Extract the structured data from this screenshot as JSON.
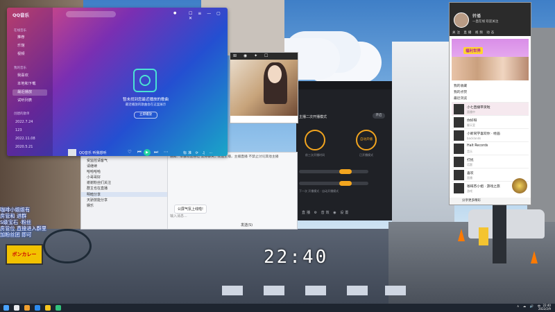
{
  "desktop": {
    "clock": "22:40",
    "danmaku": [
      "咖啡小姐姐有",
      "房管和 进群",
      "S级宝石 ·粉丝",
      "房管位 直接进入群里",
      "加粉丝团 即可"
    ],
    "shop_sign": "ボンカレー"
  },
  "qq_music": {
    "app_name": "QQ音乐",
    "sections": [
      "在线音乐",
      "我的音乐",
      "创建的歌单"
    ],
    "nav_items": [
      "推荐",
      "乐馆",
      "视频",
      "我喜欢",
      "本地和下载",
      "最近播放",
      "试听列表"
    ],
    "playlists": [
      "2022.7.24",
      "123",
      "2022.11.08",
      "2020.5.21"
    ],
    "empty_title": "暂未找到您最近播放的歌曲",
    "empty_subtitle": "最近播放的歌曲会在这里展示",
    "empty_button": "立即播放",
    "now_playing": "QQ音乐 听我想听",
    "window_controls": "☐ ≡ — ▢ ✕",
    "player_tools": "标准 ⟳ ♫ ⋯"
  },
  "chat_window": {
    "system_message": "通知：本群欢迎各位 友好聊天，欢迎主播，主播直播 不禁止讨论其他主播",
    "conversations": [
      "受监控请客气",
      "请继续",
      "哈哈哈哈",
      "小哥哥好",
      "谢谢粉丝们关注",
      "群主也在直播",
      "明暗分享",
      "天骄技能分享",
      "娱乐"
    ],
    "bubble_text": "公屏气氛上线啦!",
    "input_placeholder": "输入消息...",
    "send_label": "发送(S)"
  },
  "image_viewer": {
    "toolbar_icons": "⊞ ◉ ✦ ☐"
  },
  "dark_app": {
    "header": "主播二次开播模式",
    "pill": "开启",
    "circle_left": "",
    "circle_right": "自动开播",
    "sub_left": "前三次开播时间",
    "sub_right": "已开播模式",
    "slider_note": "下一次 开播模式 ·  自动开播模式",
    "footer": "直播 ⚙ 音效 ◉ 设置"
  },
  "phone": {
    "name": "转播",
    "tagline": "一直在线 欢迎关注",
    "tabs": "关注 直播 视频 动态",
    "banner": "福利世界",
    "menu": [
      "我的收藏",
      "我的点赞",
      "最近浏览"
    ],
    "items": [
      {
        "title": "小七直播带货啦",
        "sub": "直播中"
      },
      {
        "title": "你好呀",
        "sub": "聊天室"
      },
      {
        "title": "小新同学喜欢你  ·  绘画",
        "sub": "backlands"
      },
      {
        "title": "Halt Records",
        "sub": "音乐"
      },
      {
        "title": "打扰",
        "sub": "话题"
      },
      {
        "title": "喜欢",
        "sub": "直播"
      },
      {
        "title": "咖啡苏小姐  ·  游戏之旅",
        "sub": "游戏"
      }
    ],
    "bottom_bar": "分享更多精彩"
  },
  "taskbar": {
    "tray": "∧ ☁ 🔊 中",
    "time": "22:40",
    "date": "2022/2/9"
  }
}
